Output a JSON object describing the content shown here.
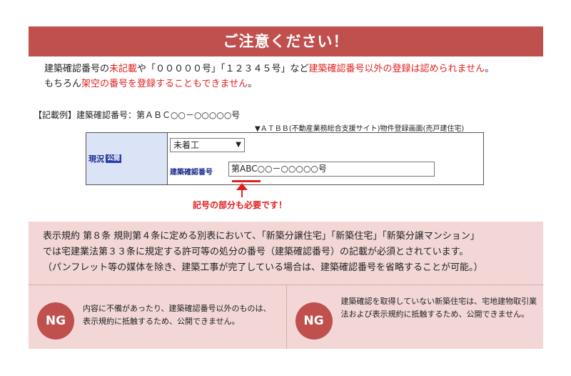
{
  "banner": {
    "title": "ご注意ください！"
  },
  "notice": {
    "line1_a": "建築確認番号の",
    "line1_b": "未記載",
    "line1_c": "や「０００００号」「１２３４５号」など",
    "line1_d": "建築確認番号以外の登録は認められません",
    "line1_e": "。",
    "line2_a": "もちろん",
    "line2_b": "架空の番号を登録することもできません",
    "line2_c": "。"
  },
  "example": {
    "label": "【記載例】建築確認番号：第ＡＢＣ○○－○○○○○号",
    "caption": "▼ＡＴＢＢ(不動産業務総合支援サイト)物件登録画面(売戸建住宅)"
  },
  "form": {
    "status_label": "現況",
    "open_badge": "公開",
    "select_value": "未着工",
    "number_label": "建築確認番号",
    "number_value": "第ABC○○－○○○○○号",
    "note": "記号の部分も必要です！"
  },
  "info": {
    "line1": "表示規約 第８条 規則第４条に定める別表において、「新築分譲住宅」「新築住宅」「新築分譲マンション」",
    "line2": "では宅建業法第３３条に規定する許可等の処分の番号（建築確認番号）の記載が必須とされています。",
    "line3": "（パンフレット等の媒体を除き、建築工事が完了している場合は、建築確認番号を省略することが可能。）"
  },
  "ng": [
    {
      "badge": "NG",
      "text": "内容に不備があったり、建築確認番号以外のものは、表示規約に抵触するため、公開できません。"
    },
    {
      "badge": "NG",
      "text": "建築確認を取得していない新築住宅は、宅地建物取引業法および表示規約に抵触するため、公開できません。"
    }
  ]
}
